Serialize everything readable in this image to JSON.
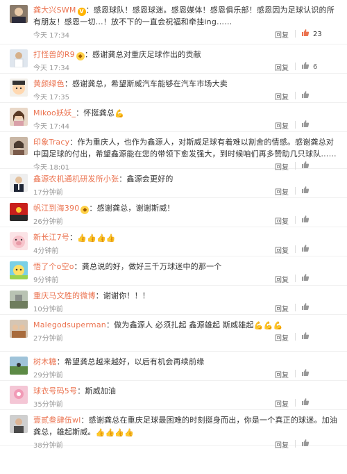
{
  "labels": {
    "reply": "回复"
  },
  "colors": {
    "username": "#eb7350",
    "liked_thumb": "#eb7350",
    "thumb": "#999999"
  },
  "comments": [
    {
      "user": "龚大兴SWM",
      "badge": "V",
      "text": "：感恩球队！感恩球迷。感恩媒体！感恩俱乐部！感恩因为足球认识的所有朋友！感恩一切…！放不下的一直会祝福和牵挂ing……",
      "time": "今天 17:34",
      "likes": "23",
      "liked": true,
      "avatar": "portrait-photo"
    },
    {
      "user": "打怪兽的R9",
      "badge": "vip",
      "text": "：感谢龚总对重庆足球作出的贡献",
      "time": "今天 17:34",
      "likes": "6",
      "liked": false,
      "avatar": "player-photo"
    },
    {
      "user": "黄颜绿色",
      "badge": "",
      "text": "：感谢龚总，希望斯威汽车能够在汽车市场大卖",
      "time": "今天 17:35",
      "likes": "",
      "liked": false,
      "avatar": "cartoon-face"
    },
    {
      "user": "Mikoo妖妖_",
      "badge": "",
      "text": "：怀挺龚总",
      "emoji": [
        "💪"
      ],
      "time": "今天 17:44",
      "likes": "",
      "liked": false,
      "avatar": "girl-photo"
    },
    {
      "user": "印象Tracy",
      "badge": "",
      "text": "：作为重庆人，也作为鑫源人，对斯威足球有着难以割舍的情感。感谢龚总对中国足球的付出，希望鑫源能在您的带领下愈发强大，到时候咱们再多赞助几只球队……",
      "time": "今天 18:01",
      "likes": "",
      "liked": false,
      "avatar": "woman-photo"
    },
    {
      "user": "鑫源农机通机研发所小张",
      "badge": "",
      "text": "：鑫源会更好的",
      "time": "17分钟前",
      "likes": "",
      "liked": false,
      "avatar": "suit-photo"
    },
    {
      "user": "帆江到海390",
      "badge": "vip",
      "text": "：感谢龚总，谢谢斯威！",
      "time": "26分钟前",
      "likes": "",
      "liked": false,
      "avatar": "red-photo"
    },
    {
      "user": "新长江7号",
      "badge": "",
      "text": "：",
      "emoji": [
        "👍",
        "👍",
        "👍",
        "👍"
      ],
      "time": "4分钟前",
      "likes": "",
      "liked": false,
      "avatar": "pig-face"
    },
    {
      "user": "悟了个o空o",
      "badge": "",
      "text": "：龚总说的好，做好三千万球迷中的那一个",
      "time": "9分钟前",
      "likes": "",
      "liked": false,
      "avatar": "colorful-avatar"
    },
    {
      "user": "重庆马文胜的微博",
      "badge": "",
      "text": "：谢谢你！！！",
      "time": "10分钟前",
      "likes": "",
      "liked": false,
      "avatar": "landscape-photo"
    },
    {
      "user": "Malegodsuperman",
      "badge": "",
      "text": "：做为鑫源人 必须扎起 鑫源雄起 斯威雄起",
      "emoji": [
        "💪",
        "💪",
        "💪"
      ],
      "time": "27分钟前",
      "likes": "",
      "liked": false,
      "avatar": "group-photo"
    },
    {
      "user": "树木糖",
      "badge": "",
      "text": "：希望龚总越来越好，以后有机会再续前缘",
      "time": "29分钟前",
      "likes": "",
      "liked": false,
      "avatar": "outdoor-photo"
    },
    {
      "user": "球衣号码5号",
      "badge": "",
      "text": "：斯威加油",
      "time": "35分钟前",
      "likes": "",
      "liked": false,
      "avatar": "pink-photo"
    },
    {
      "user": "壹贰叁肆伍wl",
      "badge": "",
      "text": "：感谢龚总在重庆足球最困难的时刻挺身而出，你是一个真正的球迷。加油龚总，雄起斯威。",
      "emoji": [
        "👍",
        "👍",
        "👍",
        "👍"
      ],
      "time": "38分钟前",
      "likes": "",
      "liked": false,
      "avatar": "person-photo"
    }
  ]
}
